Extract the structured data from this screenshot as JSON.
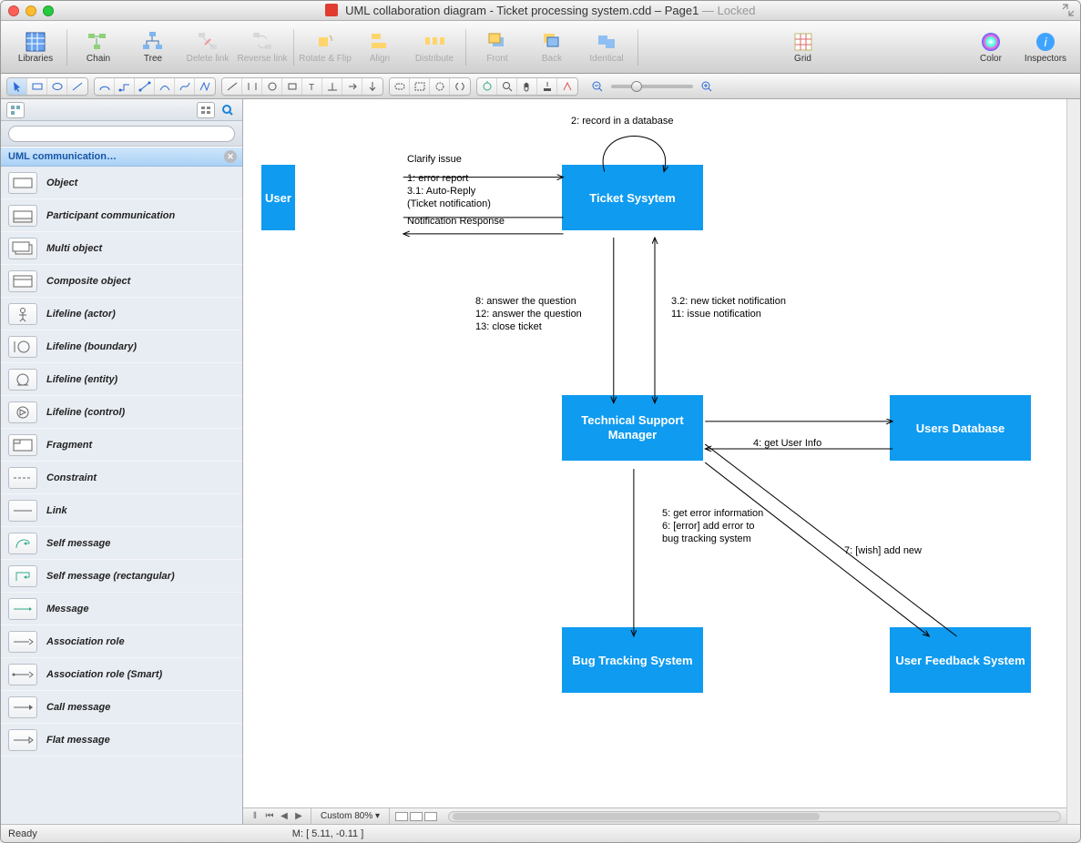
{
  "window": {
    "title_prefix": "UML collaboration diagram - Ticket processing system.cdd – Page1",
    "locked_suffix": " — Locked"
  },
  "toolbar": {
    "buttons": [
      "Libraries",
      "Chain",
      "Tree",
      "Delete link",
      "Reverse link",
      "Rotate & Flip",
      "Align",
      "Distribute",
      "Front",
      "Back",
      "Identical",
      "Grid",
      "Color",
      "Inspectors"
    ]
  },
  "sidebar": {
    "library_title": "UML communication…",
    "search_placeholder": "",
    "items": [
      "Object",
      "Participant communication",
      "Multi object",
      "Composite object",
      "Lifeline (actor)",
      "Lifeline (boundary)",
      "Lifeline (entity)",
      "Lifeline (control)",
      "Fragment",
      "Constraint",
      "Link",
      "Self message",
      "Self message (rectangular)",
      "Message",
      "Association role",
      "Association role (Smart)",
      "Call message",
      "Flat message"
    ]
  },
  "diagram": {
    "nodes": {
      "user": "User",
      "ticket": "Ticket Sysytem",
      "tsm": "Technical Support Manager",
      "udb": "Users Database",
      "bts": "Bug Tracking System",
      "ufs": "User Feedback System"
    },
    "labels": {
      "clarify": "Clarify issue",
      "msg1": "1: error report",
      "msg31": "3.1: Auto-Reply",
      "msg31b": "(Ticket notification)",
      "notif": "Notification Response",
      "record": "2: record in a database",
      "left8": "8: answer the question",
      "left12": "12: answer the question",
      "left13": "13: close ticket",
      "right32": "3.2: new ticket notification",
      "right11": "11: issue notification",
      "getuser": "4: get User Info",
      "err5": "5: get error information",
      "err6a": "6: [error] add error to",
      "err6b": "     bug tracking system",
      "wish": "7: [wish] add new"
    }
  },
  "pagestrip": {
    "zoom": "Custom 80%"
  },
  "status": {
    "ready": "Ready",
    "mouse": "M: [ 5.11, -0.11 ]"
  }
}
